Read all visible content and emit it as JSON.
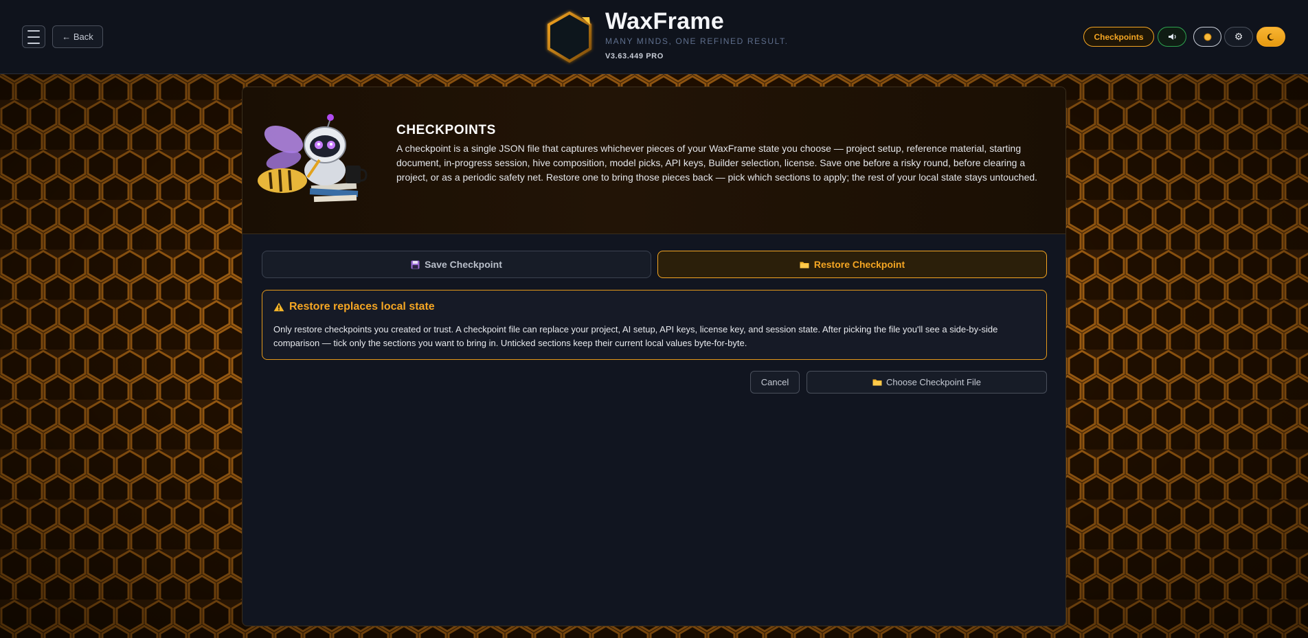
{
  "header": {
    "menu_icon": "hamburger-icon",
    "back_label": "← Back",
    "brand": {
      "title": "WaxFrame",
      "tagline": "MANY MINDS, ONE REFINED RESULT.",
      "version": "V3.63.449 PRO",
      "logo_icon": "hexagon-logo-icon"
    },
    "actions": {
      "checkpoints_label": "Checkpoints",
      "sound_icon": "speaker-icon",
      "status_icon": "status-dot-icon",
      "settings_icon": "gear-icon",
      "theme_icon": "moon-icon"
    }
  },
  "hero": {
    "title": "CHECKPOINTS",
    "description": "A checkpoint is a single JSON file that captures whichever pieces of your WaxFrame state you choose — project setup, reference material, starting document, in-progress session, hive composition, model picks, API keys, Builder selection, license. Save one before a risky round, before clearing a project, or as a periodic safety net. Restore one to bring those pieces back — pick which sections to apply; the rest of your local state stays untouched.",
    "mascot": "robot-bee-mascot"
  },
  "tabs": {
    "save_label": "Save Checkpoint",
    "save_icon": "floppy-disk-icon",
    "restore_label": "Restore Checkpoint",
    "restore_icon": "folder-icon",
    "active": "restore"
  },
  "warning": {
    "icon": "warning-icon",
    "title": "Restore replaces local state",
    "text": "Only restore checkpoints you created or trust. A checkpoint file can replace your project, AI setup, API keys, license key, and session state. After picking the file you'll see a side-by-side comparison — tick only the sections you want to bring in. Unticked sections keep their current local values byte-for-byte."
  },
  "actions": {
    "cancel_label": "Cancel",
    "choose_label": "Choose Checkpoint File",
    "choose_icon": "folder-icon"
  },
  "colors": {
    "accent": "#f5a623",
    "panel_bg": "#111520",
    "topbar_bg": "#0f131c",
    "sound_border": "#2ea44f"
  }
}
